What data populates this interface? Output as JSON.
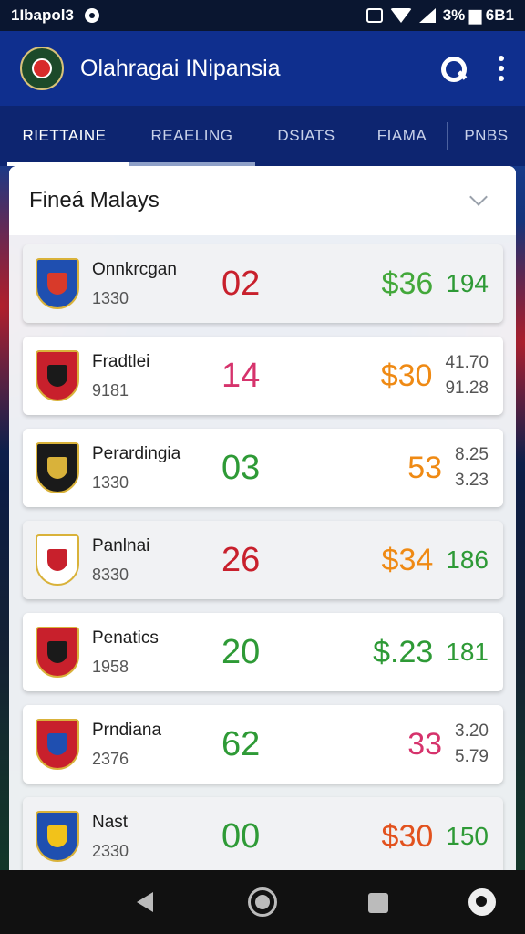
{
  "status_bar": {
    "time": "1Ibapol3",
    "battery_text": "3% ▆ 6B1"
  },
  "app": {
    "title": "Olahragai INipansia"
  },
  "tabs": [
    {
      "label": "RIETTAINE",
      "active": true
    },
    {
      "label": "REAELING",
      "active": false
    },
    {
      "label": "DSIATS",
      "active": false
    },
    {
      "label": "FIAMA",
      "active": false
    },
    {
      "label": "PNBS",
      "active": false
    }
  ],
  "panel": {
    "title": "Fineá Malays"
  },
  "rows": [
    {
      "name": "Onnkrcgan",
      "sub": "1330",
      "score": "02",
      "score_color": "#c8202c",
      "price": "$36",
      "price_color": "#43a83a",
      "stat": "194",
      "stat_color": "#2e9a36",
      "odds": null,
      "crest_colors": [
        "#1f4fb0",
        "#d83a2a"
      ]
    },
    {
      "name": "Fradtlei",
      "sub": "9181",
      "score": "14",
      "score_color": "#d6336c",
      "price": "$30",
      "price_color": "#ef8a14",
      "stat": null,
      "odds": [
        "41.70",
        "91.28"
      ],
      "crest_colors": [
        "#c8202c",
        "#1a1a1a"
      ]
    },
    {
      "name": "Perardingia",
      "sub": "1330",
      "score": "03",
      "score_color": "#2e9a36",
      "price": "53",
      "price_color": "#ef8a14",
      "stat": null,
      "odds": [
        "8.25",
        "3.23"
      ],
      "crest_colors": [
        "#1a1a1a",
        "#d9b23a"
      ]
    },
    {
      "name": "Panlnai",
      "sub": "8330",
      "score": "26",
      "score_color": "#c8202c",
      "price": "$34",
      "price_color": "#ef8a14",
      "stat": "186",
      "stat_color": "#2e9a36",
      "odds": null,
      "crest_colors": [
        "#ffffff",
        "#c8202c"
      ]
    },
    {
      "name": "Penatics",
      "sub": "1958",
      "score": "20",
      "score_color": "#2e9a36",
      "price": "$.23",
      "price_color": "#2e9a36",
      "stat": "181",
      "stat_color": "#2e9a36",
      "odds": null,
      "crest_colors": [
        "#c8202c",
        "#1a1a1a"
      ]
    },
    {
      "name": "Prndiana",
      "sub": "2376",
      "score": "62",
      "score_color": "#2e9a36",
      "price": "33",
      "price_color": "#d6336c",
      "stat": null,
      "odds": [
        "3.20",
        "5.79"
      ],
      "crest_colors": [
        "#c8202c",
        "#1f4fb0"
      ]
    },
    {
      "name": "Nast",
      "sub": "2330",
      "score": "00",
      "score_color": "#2e9a36",
      "price": "$30",
      "price_color": "#e2521e",
      "stat": "150",
      "stat_color": "#2e9a36",
      "odds": null,
      "crest_colors": [
        "#1f4fb0",
        "#f2c21a"
      ]
    }
  ]
}
